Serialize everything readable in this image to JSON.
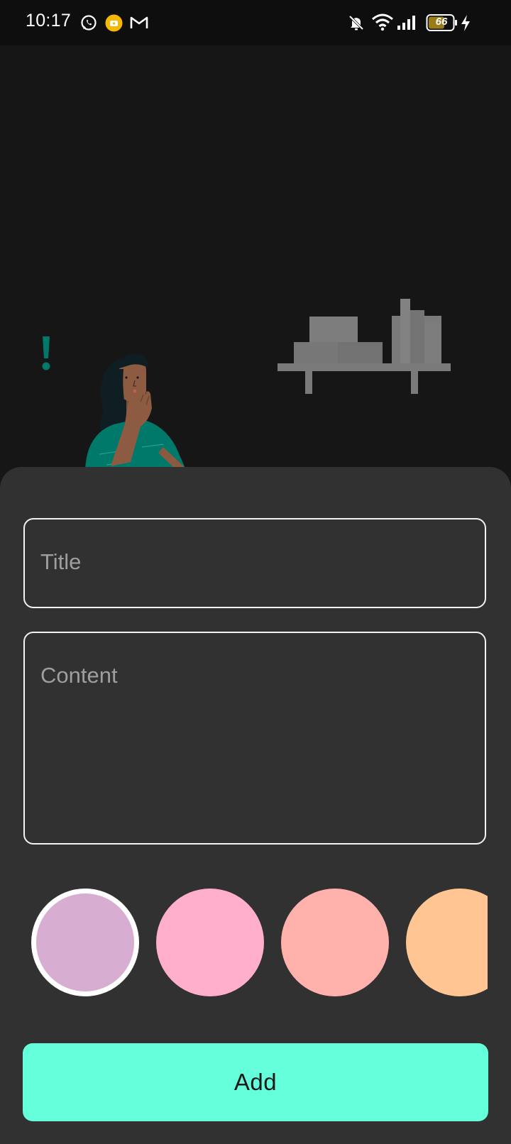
{
  "status_bar": {
    "time": "10:17",
    "icons": [
      "whatsapp-icon",
      "notification-app-icon",
      "gmail-icon",
      "mute-icon",
      "wifi-icon",
      "signal-icon",
      "battery-icon",
      "charging-icon"
    ],
    "battery_level": "66"
  },
  "illustration": {
    "description_icons": [
      "exclamation-icon",
      "woman-figure",
      "bookshelf"
    ],
    "accent_color": "#00796b",
    "shelf_color": "#7a7a7a"
  },
  "form": {
    "title_placeholder": "Title",
    "content_placeholder": "Content",
    "colors": [
      {
        "hex": "#d7aed1",
        "selected": true
      },
      {
        "hex": "#ffaecb",
        "selected": false
      },
      {
        "hex": "#ffb2ab",
        "selected": false
      },
      {
        "hex": "#ffc593",
        "selected": false
      }
    ],
    "add_label": "Add",
    "add_button_color": "#64ffda"
  }
}
